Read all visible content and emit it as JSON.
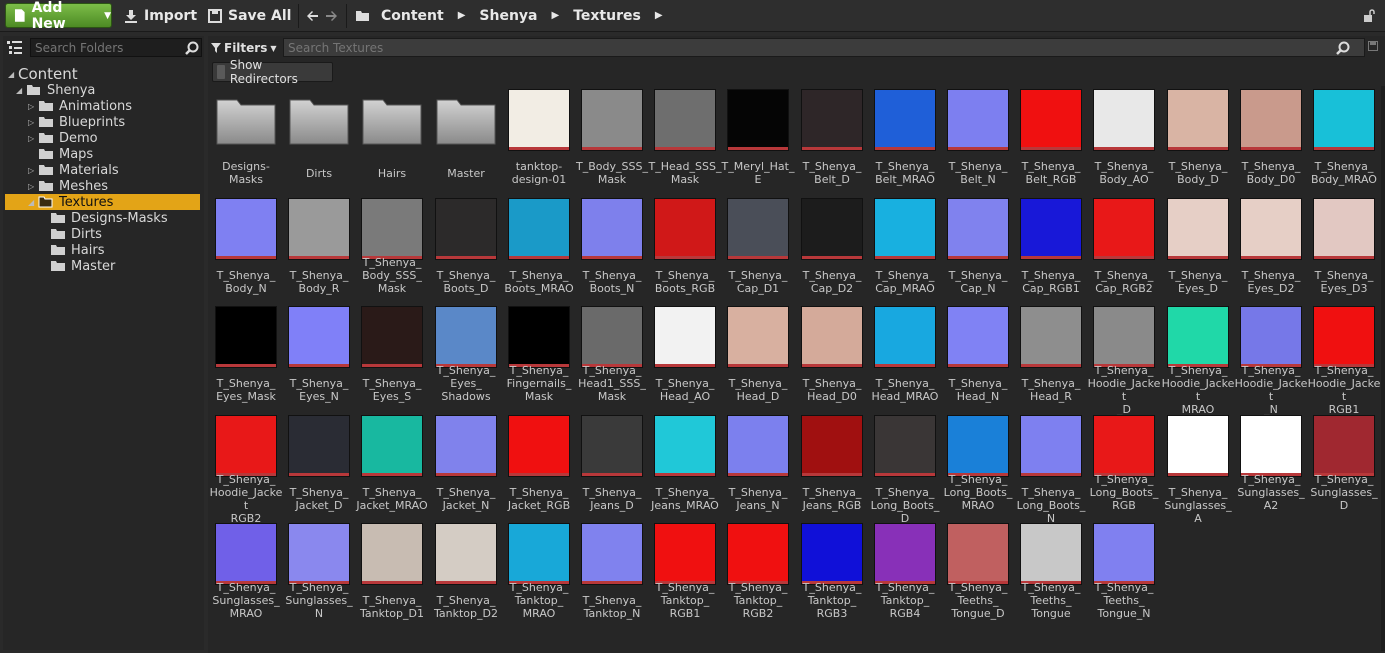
{
  "toolbar": {
    "add_new_label": "Add New",
    "import_label": "Import",
    "save_all_label": "Save All"
  },
  "path": [
    "Content",
    "Shenya",
    "Textures"
  ],
  "left_panel": {
    "search_placeholder": "Search Folders",
    "tree": [
      {
        "label": "Content",
        "level": 0,
        "expanded": true
      },
      {
        "label": "Shenya",
        "level": 1,
        "expanded": true
      },
      {
        "label": "Animations",
        "level": 2,
        "expandable": true
      },
      {
        "label": "Blueprints",
        "level": 2,
        "expandable": true
      },
      {
        "label": "Demo",
        "level": 2,
        "expandable": true
      },
      {
        "label": "Maps",
        "level": 2,
        "expandable": false
      },
      {
        "label": "Materials",
        "level": 2,
        "expandable": true
      },
      {
        "label": "Meshes",
        "level": 2,
        "expandable": true
      },
      {
        "label": "Textures",
        "level": 2,
        "expanded": true,
        "selected": true
      },
      {
        "label": "Designs-Masks",
        "level": 3
      },
      {
        "label": "Dirts",
        "level": 3
      },
      {
        "label": "Hairs",
        "level": 3
      },
      {
        "label": "Master",
        "level": 3
      }
    ]
  },
  "filters": {
    "filters_label": "Filters",
    "search_placeholder": "Search Textures",
    "show_redirectors_label": "Show Redirectors"
  },
  "assets": [
    {
      "name": "Designs-\nMasks",
      "kind": "folder"
    },
    {
      "name": "Dirts",
      "kind": "folder"
    },
    {
      "name": "Hairs",
      "kind": "folder"
    },
    {
      "name": "Master",
      "kind": "folder"
    },
    {
      "name": "tanktop-\ndesign-01",
      "kind": "texture",
      "bg": "#f2ede4"
    },
    {
      "name": "T_Body_SSS_\nMask",
      "kind": "texture",
      "bg": "#8a8a8a"
    },
    {
      "name": "T_Head_SSS_\nMask",
      "kind": "texture",
      "bg": "#6e6e6e"
    },
    {
      "name": "T_Meryl_Hat_\nE",
      "kind": "texture",
      "bg": "#050505"
    },
    {
      "name": "T_Shenya_\nBelt_D",
      "kind": "texture",
      "bg": "#2e2628"
    },
    {
      "name": "T_Shenya_\nBelt_MRAO",
      "kind": "texture",
      "bg": "#1f5fd8"
    },
    {
      "name": "T_Shenya_\nBelt_N",
      "kind": "texture",
      "bg": "#7d7ff0"
    },
    {
      "name": "T_Shenya_\nBelt_RGB",
      "kind": "texture",
      "bg": "#f01010"
    },
    {
      "name": "T_Shenya_\nBody_AO",
      "kind": "texture",
      "bg": "#e8e8e8"
    },
    {
      "name": "T_Shenya_\nBody_D",
      "kind": "texture",
      "bg": "#d9b4a4"
    },
    {
      "name": "T_Shenya_\nBody_D0",
      "kind": "texture",
      "bg": "#c99a8c"
    },
    {
      "name": "T_Shenya_\nBody_MRAO",
      "kind": "texture",
      "bg": "#18c0d8"
    },
    {
      "name": "T_Shenya_\nBody_N",
      "kind": "texture",
      "bg": "#7f80f2"
    },
    {
      "name": "T_Shenya_\nBody_R",
      "kind": "texture",
      "bg": "#9a9a9a"
    },
    {
      "name": "T_Shenya_\nBody_SSS_\nMask",
      "kind": "texture",
      "bg": "#7a7a7a"
    },
    {
      "name": "T_Shenya_\nBoots_D",
      "kind": "texture",
      "bg": "#2c2a2a"
    },
    {
      "name": "T_Shenya_\nBoots_MRAO",
      "kind": "texture",
      "bg": "#1a9ac8"
    },
    {
      "name": "T_Shenya_\nBoots_N",
      "kind": "texture",
      "bg": "#7e80ec"
    },
    {
      "name": "T_Shenya_\nBoots_RGB",
      "kind": "texture",
      "bg": "#d01818"
    },
    {
      "name": "T_Shenya_\nCap_D1",
      "kind": "texture",
      "bg": "#4a4e58"
    },
    {
      "name": "T_Shenya_\nCap_D2",
      "kind": "texture",
      "bg": "#1c1c1c"
    },
    {
      "name": "T_Shenya_\nCap_MRAO",
      "kind": "texture",
      "bg": "#18b0e0"
    },
    {
      "name": "T_Shenya_\nCap_N",
      "kind": "texture",
      "bg": "#8082ee"
    },
    {
      "name": "T_Shenya_\nCap_RGB1",
      "kind": "texture",
      "bg": "#1818d8"
    },
    {
      "name": "T_Shenya_\nCap_RGB2",
      "kind": "texture",
      "bg": "#e81818"
    },
    {
      "name": "T_Shenya_\nEyes_D",
      "kind": "texture",
      "bg": "#e6cfc6"
    },
    {
      "name": "T_Shenya_\nEyes_D2",
      "kind": "texture",
      "bg": "#e6cfc6"
    },
    {
      "name": "T_Shenya_\nEyes_D3",
      "kind": "texture",
      "bg": "#e2c8c2"
    },
    {
      "name": "T_Shenya_\nEyes_Mask",
      "kind": "texture",
      "bg": "#000000"
    },
    {
      "name": "T_Shenya_\nEyes_N",
      "kind": "texture",
      "bg": "#8080f8"
    },
    {
      "name": "T_Shenya_\nEyes_S",
      "kind": "texture",
      "bg": "#2a1a18"
    },
    {
      "name": "T_Shenya_\nEyes_\nShadows",
      "kind": "texture",
      "bg": "#5a88c8"
    },
    {
      "name": "T_Shenya_\nFingernails_\nMask",
      "kind": "texture",
      "bg": "#000000"
    },
    {
      "name": "T_Shenya_\nHead1_SSS_\nMask",
      "kind": "texture",
      "bg": "#6a6a6a"
    },
    {
      "name": "T_Shenya_\nHead_AO",
      "kind": "texture",
      "bg": "#f2f2f2"
    },
    {
      "name": "T_Shenya_\nHead_D",
      "kind": "texture",
      "bg": "#d8b0a0"
    },
    {
      "name": "T_Shenya_\nHead_D0",
      "kind": "texture",
      "bg": "#d4aa9a"
    },
    {
      "name": "T_Shenya_\nHead_MRAO",
      "kind": "texture",
      "bg": "#18a8e0"
    },
    {
      "name": "T_Shenya_\nHead_N",
      "kind": "texture",
      "bg": "#8082f4"
    },
    {
      "name": "T_Shenya_\nHead_R",
      "kind": "texture",
      "bg": "#8e8e8e"
    },
    {
      "name": "T_Shenya_\nHoodie_Jacket\n_D",
      "kind": "texture",
      "bg": "#8a8a8a"
    },
    {
      "name": "T_Shenya_\nHoodie_Jacket\nMRAO",
      "kind": "texture",
      "bg": "#20d8a8"
    },
    {
      "name": "T_Shenya_\nHoodie_Jacket\n_N",
      "kind": "texture",
      "bg": "#7678e8"
    },
    {
      "name": "T_Shenya_\nHoodie_Jacket\nRGB1",
      "kind": "texture",
      "bg": "#f01010"
    },
    {
      "name": "T_Shenya_\nHoodie_Jacket\nRGB2",
      "kind": "texture",
      "bg": "#e81818"
    },
    {
      "name": "T_Shenya_\nJacket_D",
      "kind": "texture",
      "bg": "#2a2c34"
    },
    {
      "name": "T_Shenya_\nJacket_MRAO",
      "kind": "texture",
      "bg": "#18b8a0"
    },
    {
      "name": "T_Shenya_\nJacket_N",
      "kind": "texture",
      "bg": "#8082ec"
    },
    {
      "name": "T_Shenya_\nJacket_RGB",
      "kind": "texture",
      "bg": "#f01010"
    },
    {
      "name": "T_Shenya_\nJeans_D",
      "kind": "texture",
      "bg": "#3a3a3a"
    },
    {
      "name": "T_Shenya_\nJeans_MRAO",
      "kind": "texture",
      "bg": "#20c8d8"
    },
    {
      "name": "T_Shenya_\nJeans_N",
      "kind": "texture",
      "bg": "#7c80ee"
    },
    {
      "name": "T_Shenya_\nJeans_RGB",
      "kind": "texture",
      "bg": "#a01010"
    },
    {
      "name": "T_Shenya_\nLong_Boots_D",
      "kind": "texture",
      "bg": "#3a3636"
    },
    {
      "name": "T_Shenya_\nLong_Boots_\nMRAO",
      "kind": "texture",
      "bg": "#1a80d8"
    },
    {
      "name": "T_Shenya_\nLong_Boots_N",
      "kind": "texture",
      "bg": "#7e80f0"
    },
    {
      "name": "T_Shenya_\nLong_Boots_\nRGB",
      "kind": "texture",
      "bg": "#e81818"
    },
    {
      "name": "T_Shenya_\nSunglasses_A",
      "kind": "texture",
      "bg": "#ffffff"
    },
    {
      "name": "T_Shenya_\nSunglasses_\nA2",
      "kind": "texture",
      "bg": "#ffffff"
    },
    {
      "name": "T_Shenya_\nSunglasses_\nD",
      "kind": "texture",
      "bg": "#a02830"
    },
    {
      "name": "T_Shenya_\nSunglasses_\nMRAO",
      "kind": "texture",
      "bg": "#7060e8"
    },
    {
      "name": "T_Shenya_\nSunglasses_\nN",
      "kind": "texture",
      "bg": "#8a88ee"
    },
    {
      "name": "T_Shenya_\nTanktop_D1",
      "kind": "texture",
      "bg": "#c8bcb2"
    },
    {
      "name": "T_Shenya_\nTanktop_D2",
      "kind": "texture",
      "bg": "#d4ccc4"
    },
    {
      "name": "T_Shenya_\nTanktop_\nMRAO",
      "kind": "texture",
      "bg": "#18a8d8"
    },
    {
      "name": "T_Shenya_\nTanktop_N",
      "kind": "texture",
      "bg": "#8082ee"
    },
    {
      "name": "T_Shenya_\nTanktop_\nRGB1",
      "kind": "texture",
      "bg": "#f01010"
    },
    {
      "name": "T_Shenya_\nTanktop_\nRGB2",
      "kind": "texture",
      "bg": "#f01010"
    },
    {
      "name": "T_Shenya_\nTanktop_\nRGB3",
      "kind": "texture",
      "bg": "#1010d8"
    },
    {
      "name": "T_Shenya_\nTanktop_\nRGB4",
      "kind": "texture",
      "bg": "#8830b8"
    },
    {
      "name": "T_Shenya_\nTeeths_\nTongue_D",
      "kind": "texture",
      "bg": "#c06060"
    },
    {
      "name": "T_Shenya_\nTeeths_\nTongue",
      "kind": "texture",
      "bg": "#c8c8c8"
    },
    {
      "name": "T_Shenya_\nTeeths_\nTongue_N",
      "kind": "texture",
      "bg": "#8080f0"
    }
  ]
}
